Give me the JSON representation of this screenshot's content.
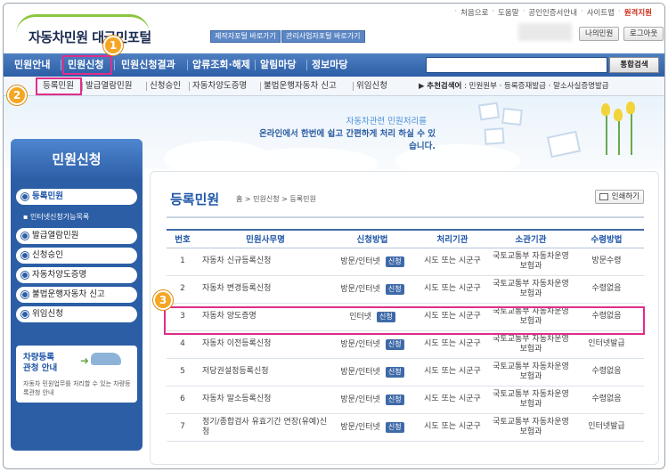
{
  "header": {
    "logo_text": "자동차민원 대국민포털",
    "shortcut_1": "제작자포털 바로가기",
    "shortcut_2": "관리사업자포털 바로가기",
    "top_links": [
      "처음으로",
      "도움말",
      "공인인증서안내",
      "사이트맵"
    ],
    "top_link_accent": "원격지원",
    "btn_my": "나의민원",
    "btn_logout": "로그아웃"
  },
  "mainnav": {
    "items": [
      "민원안내",
      "민원신청",
      "민원신청결과",
      "압류조회·해제",
      "알림마당",
      "정보마당"
    ],
    "search_placeholder": "",
    "search_button": "통합검색"
  },
  "subnav": {
    "items": [
      "등록민원",
      "발급열람민원",
      "신청승인",
      "자동차양도증명",
      "불법운행자동차 신고",
      "위임신청"
    ],
    "recommend_label": "추천검색어",
    "recommend_items": [
      "민원원부",
      "등록증재발급",
      "말소사실증명발급"
    ]
  },
  "banner": {
    "line1": "자동차관련 민원처리를",
    "line2": "온라인에서 한번에 쉽고 간편하게 처리 하실 수 있습니다."
  },
  "sidebar": {
    "title": "민원신청",
    "items": [
      "등록민원",
      "발급열람민원",
      "신청승인",
      "자동차양도증명",
      "불법운행자동차 신고",
      "위임신청"
    ],
    "sub_item": "인터넷신청가능목록",
    "promo_title_1": "차량등록",
    "promo_title_2": "관청 안내",
    "promo_desc": "자동차 민원업무를 처리할 수 있는 차량등록관청 안내"
  },
  "content": {
    "title": "등록민원",
    "breadcrumb": "홈 > 민원신청 > 등록민원",
    "print": "인쇄하기",
    "columns": [
      "번호",
      "민원사무명",
      "신청방법",
      "처리기관",
      "소관기관",
      "수령방법"
    ],
    "apply_label": "신청",
    "rows": [
      {
        "no": "1",
        "name": "자동차 신규등록신청",
        "method": "방문/인터넷",
        "proc": "시도 또는 시군구",
        "org": "국토교통부 자동차운영보험과",
        "recv": "방문수령"
      },
      {
        "no": "2",
        "name": "자동차 변경등록신청",
        "method": "방문/인터넷",
        "proc": "시도 또는 시군구",
        "org": "국토교통부 자동차운영보험과",
        "recv": "수령없음"
      },
      {
        "no": "3",
        "name": "자동차 양도증명",
        "method": "인터넷",
        "proc": "시도 또는 시군구",
        "org": "국토교통부 자동차운영보험과",
        "recv": "수령없음"
      },
      {
        "no": "4",
        "name": "자동차 이전등록신청",
        "method": "방문/인터넷",
        "proc": "시도 또는 시군구",
        "org": "국토교통부 자동차운영보험과",
        "recv": "인터넷발급"
      },
      {
        "no": "5",
        "name": "저당권설정등록신청",
        "method": "방문/인터넷",
        "proc": "시도 또는 시군구",
        "org": "국토교통부 자동차운영보험과",
        "recv": "수령없음"
      },
      {
        "no": "6",
        "name": "자동차 말소등록신청",
        "method": "방문/인터넷",
        "proc": "시도 또는 시군구",
        "org": "국토교통부 자동차운영보험과",
        "recv": "수령없음"
      },
      {
        "no": "7",
        "name": "정기/종합검사 유효기간 연장(유예)신청",
        "method": "방문/인터넷",
        "proc": "시도 또는 시군구",
        "org": "국토교통부 자동차운영보험과",
        "recv": "인터넷발급"
      }
    ]
  },
  "annotations": {
    "badges": [
      "1",
      "2",
      "3"
    ],
    "highlight_color": "#e02d8a",
    "badge_color": "#f5a623"
  }
}
